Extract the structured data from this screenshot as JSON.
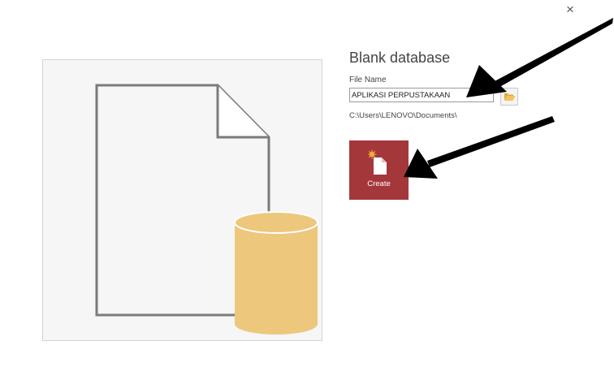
{
  "dialog": {
    "close_glyph": "×",
    "title": "Blank database",
    "file_name_label": "File Name",
    "file_name_value": "APLIKASI PERPUSTAKAAN",
    "path": "C:\\Users\\LENOVO\\Documents\\",
    "create_label": "Create"
  },
  "colors": {
    "create_button": "#a4373a",
    "database_cylinder": "#edc77c",
    "document_outline": "#7b7b7b"
  },
  "icons": {
    "preview": "blank-document-with-database-icon",
    "browse": "folder-open-icon",
    "create": "new-document-icon"
  }
}
